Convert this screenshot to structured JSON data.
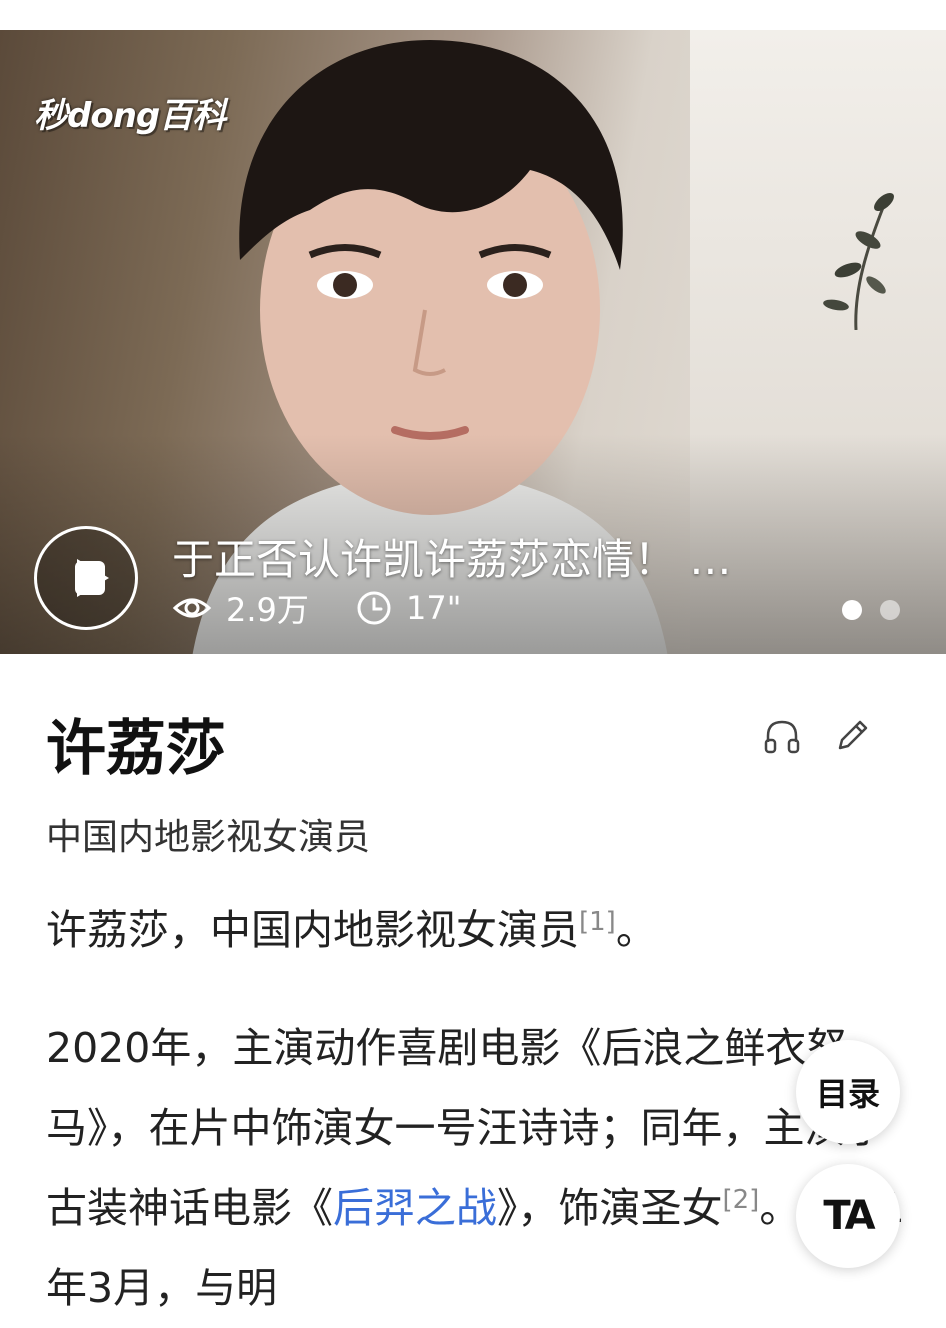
{
  "hero": {
    "logo_text": "秒dong百科",
    "video_title": "于正否认许凯许荔莎恋情！ …",
    "view_count": "2.9万",
    "duration": "17\"",
    "carousel_pages": 2,
    "carousel_active": 1
  },
  "entry": {
    "title": "许荔莎",
    "subtitle": "中国内地影视女演员"
  },
  "content": {
    "intro_text": "许荔莎，中国内地影视女演员",
    "intro_ref": "[1]",
    "intro_end": "。",
    "para2_part1": "2020年，主演动作喜剧电影《后浪之鲜衣怒马》，在片中饰演女一号汪诗诗；同年，主演了古装神话电影《",
    "para2_link": "后羿之战",
    "para2_part2": "》，饰演圣女",
    "para2_ref": "[2]",
    "para2_part3": "。2021年3月，与明"
  },
  "floating": {
    "toc_label": "目录",
    "ta_label": "TA"
  },
  "colors": {
    "link": "#3a6ed8",
    "title": "#111111"
  }
}
